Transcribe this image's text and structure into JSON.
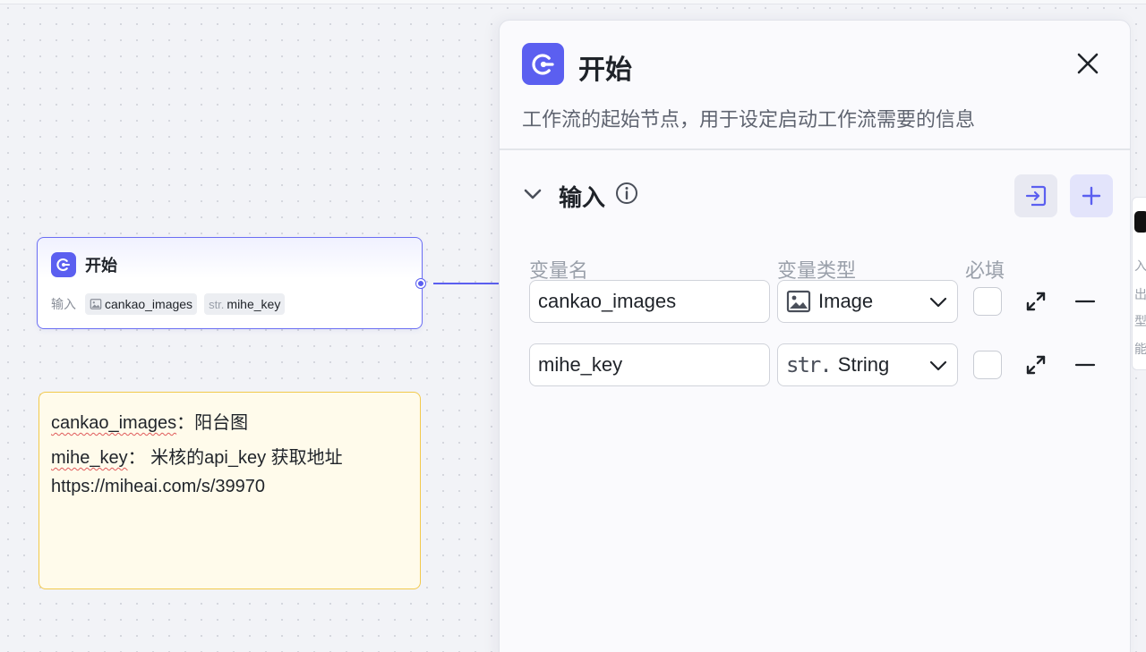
{
  "canvas": {
    "start_node": {
      "title": "开始",
      "io_label": "输入",
      "inputs": [
        {
          "type_tag": "",
          "name": "cankao_images",
          "icon": "image-icon"
        },
        {
          "type_tag": "str.",
          "name": "mihe_key",
          "icon": ""
        }
      ]
    },
    "note": {
      "line1_key": "cankao_images",
      "line1_rest": "：阳台图",
      "line2_key": "mihe_key",
      "line2_rest": "： 米核的api_key 获取地址",
      "line3": "https://miheai.com/s/39970"
    }
  },
  "panel": {
    "title": "开始",
    "description": "工作流的起始节点，用于设定启动工作流需要的信息",
    "section_title": "输入",
    "columns": {
      "name": "变量名",
      "type": "变量类型",
      "required": "必填"
    },
    "rows": [
      {
        "name": "cankao_images",
        "type": "Image",
        "type_icon": "image-icon",
        "type_prefix": "",
        "required": false
      },
      {
        "name": "mihe_key",
        "type": "String",
        "type_icon": "",
        "type_prefix": "str.",
        "required": false
      }
    ]
  },
  "edge_panel": {
    "chars": [
      "入",
      "出",
      "型",
      "能"
    ]
  },
  "colors": {
    "accent": "#5b5ff0",
    "note_border": "#f2c94c",
    "note_bg": "#fffbeb"
  }
}
